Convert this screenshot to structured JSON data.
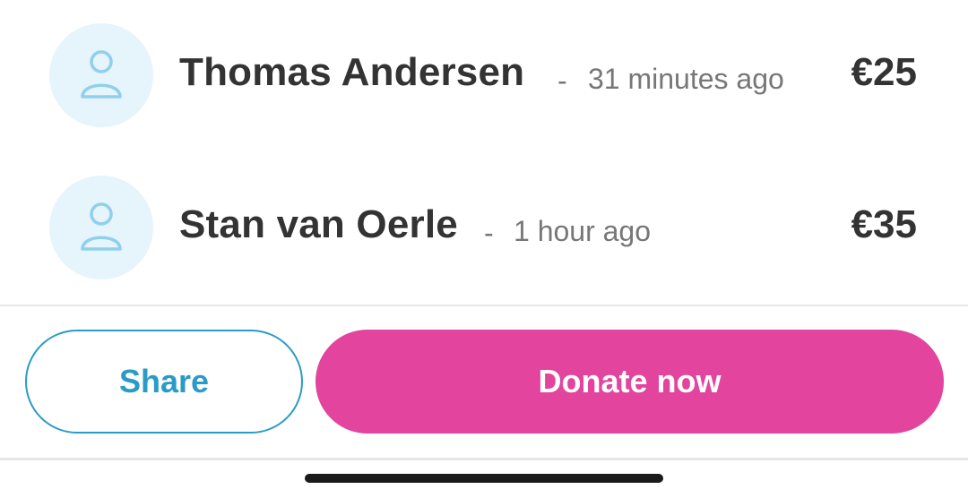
{
  "donations": [
    {
      "name": "Thomas Andersen",
      "separator": "-",
      "time": "31 minutes ago",
      "amount": "€25",
      "avatar_icon": "user-icon"
    },
    {
      "name": "Stan van Oerle",
      "separator": "-",
      "time": "1 hour ago",
      "amount": "€35",
      "avatar_icon": "user-icon"
    }
  ],
  "actions": {
    "share_label": "Share",
    "donate_label": "Donate now"
  },
  "colors": {
    "accent_blue": "#2a9bc6",
    "donate_pink": "#e2449e",
    "avatar_bg": "#e6f4fb",
    "avatar_icon": "#8fd0ee",
    "text_dark": "#333333",
    "text_muted": "#777777"
  }
}
